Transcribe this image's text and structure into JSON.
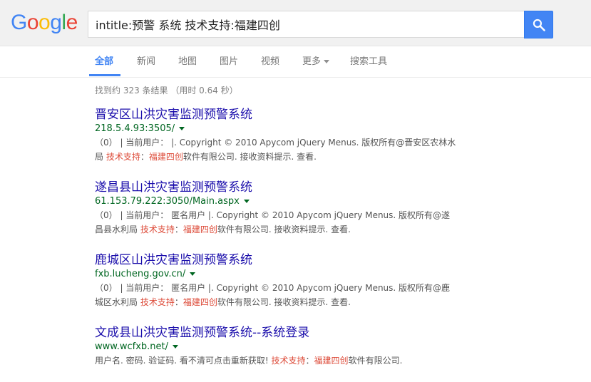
{
  "logo": {
    "letters": [
      "G",
      "o",
      "o",
      "g",
      "l",
      "e"
    ],
    "colors": [
      "#4285f4",
      "#ea4335",
      "#fbbc05",
      "#4285f4",
      "#34a853",
      "#ea4335"
    ]
  },
  "search": {
    "query": "intitle:预警 系统 技术支持:福建四创"
  },
  "nav": {
    "all": "全部",
    "news": "新闻",
    "maps": "地图",
    "images": "图片",
    "videos": "视频",
    "more": "更多",
    "tools": "搜索工具"
  },
  "stats": "找到约 323 条结果 （用时 0.64 秒）",
  "results": [
    {
      "title": "晋安区山洪灾害监测预警系统",
      "url": "218.5.4.93:3505/",
      "snippet_a": "（0） | 当前用户： |. Copyright © 2010 Apycom jQuery Menus. 版权所有@晋安区农林水局 ",
      "hl1": "技术支持",
      "colon": "：",
      "hl2": "福建四创",
      "snippet_b": "软件有限公司. 接收资料提示. 查看."
    },
    {
      "title": "遂昌县山洪灾害监测预警系统",
      "url": "61.153.79.222:3050/Main.aspx",
      "snippet_a": "（0） | 当前用户： 匿名用户 |. Copyright © 2010 Apycom jQuery Menus. 版权所有@遂昌县水利局 ",
      "hl1": "技术支持",
      "colon": "：",
      "hl2": "福建四创",
      "snippet_b": "软件有限公司. 接收资料提示. 查看."
    },
    {
      "title": "鹿城区山洪灾害监测预警系统",
      "url": "fxb.lucheng.gov.cn/",
      "snippet_a": "（0） | 当前用户： 匿名用户 |. Copyright © 2010 Apycom jQuery Menus. 版权所有@鹿城区水利局 ",
      "hl1": "技术支持",
      "colon": "：",
      "hl2": "福建四创",
      "snippet_b": "软件有限公司. 接收资料提示. 查看."
    },
    {
      "title": "文成县山洪灾害监测预警系统--系统登录",
      "url": "www.wcfxb.net/",
      "snippet_a": "用户名. 密码. 验证码. 看不清可点击重新获取! ",
      "hl1": "技术支持",
      "colon": "：",
      "hl2": "福建四创",
      "snippet_b": "软件有限公司."
    }
  ]
}
